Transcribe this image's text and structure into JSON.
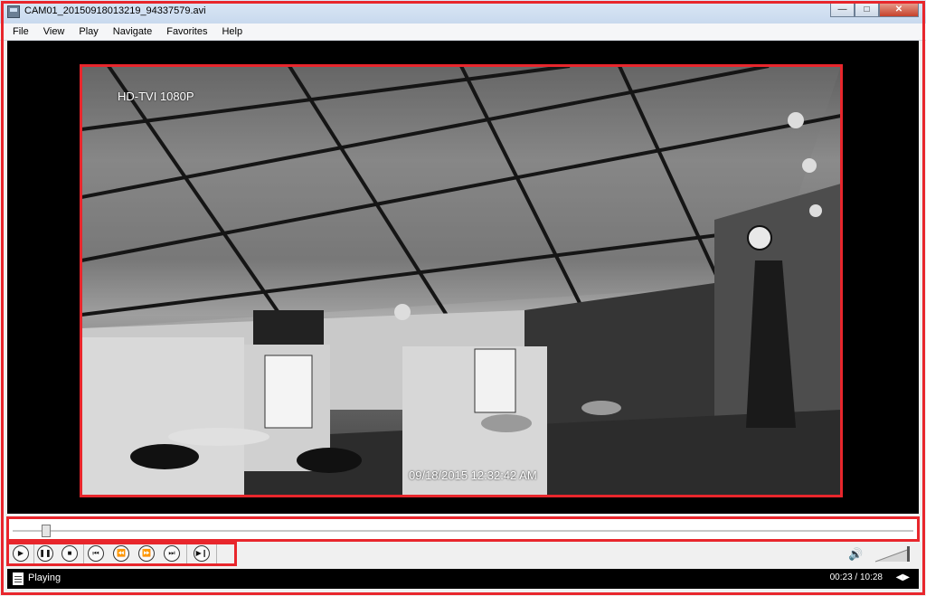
{
  "window": {
    "title": "CAM01_20150918013219_94337579.avi"
  },
  "menu": {
    "items": [
      "File",
      "View",
      "Play",
      "Navigate",
      "Favorites",
      "Help"
    ]
  },
  "video": {
    "overlay_resolution": "HD-TVI 1080P",
    "overlay_timestamp": "09/18/2015 12:32:42 AM"
  },
  "playback": {
    "position_fraction": 0.037
  },
  "controls": {
    "buttons": [
      {
        "name": "play-icon",
        "glyph": "▶"
      },
      {
        "name": "pause-icon",
        "glyph": "❚❚"
      },
      {
        "name": "stop-icon",
        "glyph": "■"
      },
      {
        "name": "skip-back-icon",
        "glyph": "⏮"
      },
      {
        "name": "rewind-icon",
        "glyph": "⏪"
      },
      {
        "name": "fast-forward-icon",
        "glyph": "⏩"
      },
      {
        "name": "skip-forward-icon",
        "glyph": "⏭"
      },
      {
        "name": "frame-step-icon",
        "glyph": "▶❙"
      }
    ],
    "volume_icon": "speaker-icon"
  },
  "status": {
    "state": "Playing",
    "time": "00:23 / 10:28"
  },
  "colors": {
    "highlight": "#e8262c",
    "titlebar": "#c8d9ee"
  }
}
